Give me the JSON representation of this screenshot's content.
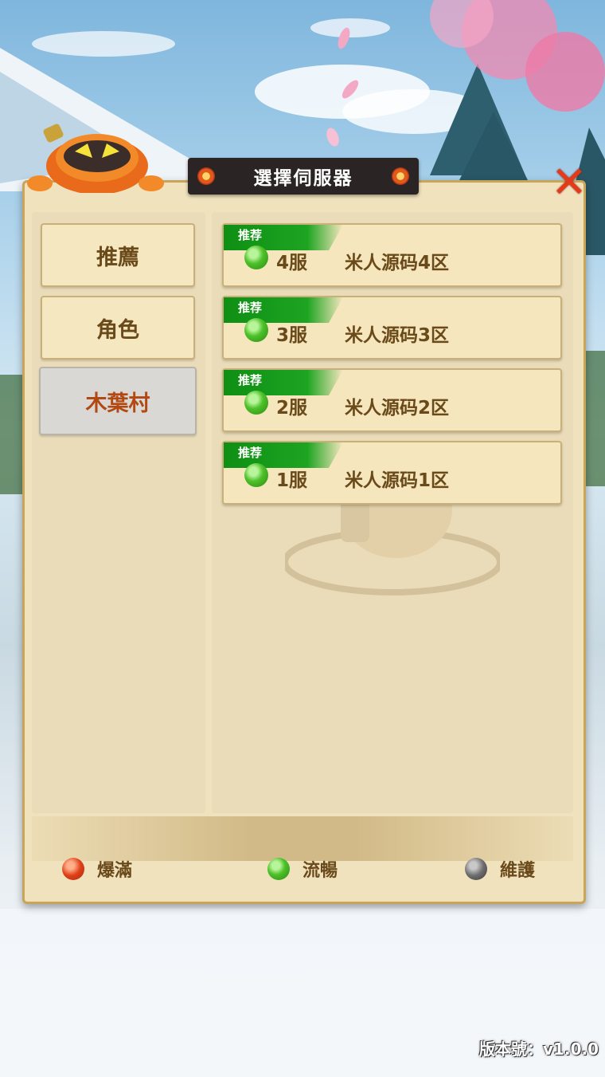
{
  "title": "選擇伺服器",
  "tabs": [
    {
      "label": "推薦",
      "active": false
    },
    {
      "label": "角色",
      "active": false
    },
    {
      "label": "木葉村",
      "active": true
    }
  ],
  "servers": [
    {
      "tag": "推荐",
      "num": "4服",
      "name": "米人源码4区",
      "status": "smooth"
    },
    {
      "tag": "推荐",
      "num": "3服",
      "name": "米人源码3区",
      "status": "smooth"
    },
    {
      "tag": "推荐",
      "num": "2服",
      "name": "米人源码2区",
      "status": "smooth"
    },
    {
      "tag": "推荐",
      "num": "1服",
      "name": "米人源码1区",
      "status": "smooth"
    }
  ],
  "legend": {
    "full": "爆滿",
    "smooth": "流暢",
    "maintenance": "維護"
  },
  "colors": {
    "full": "#e0401a",
    "smooth": "#4ec12a",
    "maintenance": "#6e6e6e"
  },
  "version": "版本號：v1.0.0"
}
